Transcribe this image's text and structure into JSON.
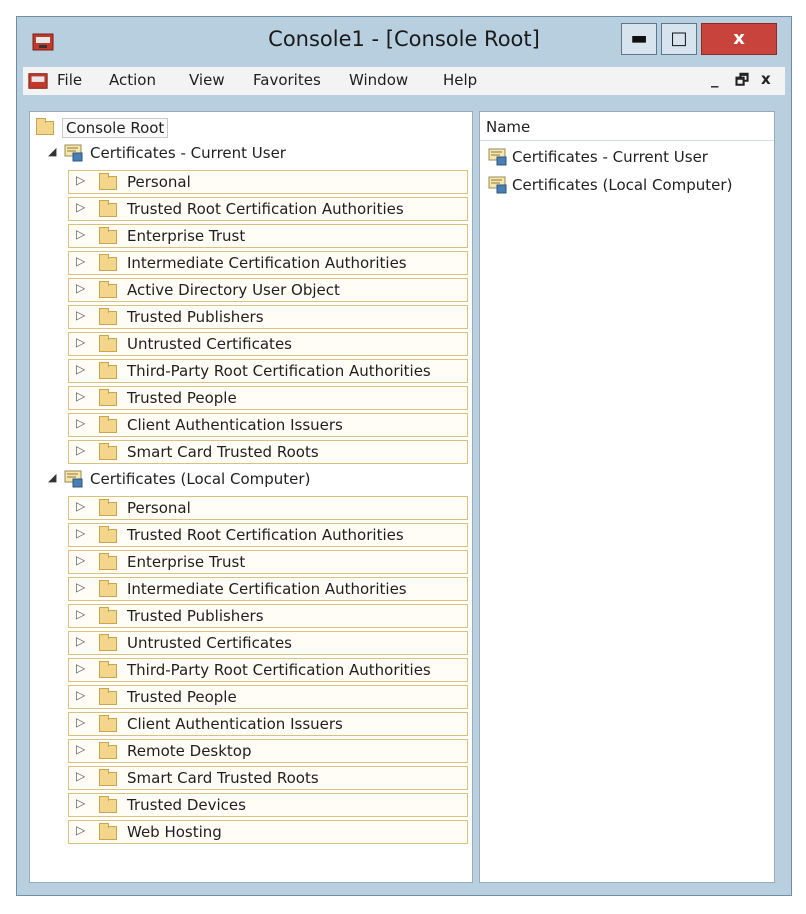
{
  "window": {
    "title": "Console1 - [Console Root]",
    "controls": {
      "minimize": "▬",
      "maximize": "□",
      "close": "x"
    }
  },
  "menu": {
    "items": [
      "File",
      "Action",
      "View",
      "Favorites",
      "Window",
      "Help"
    ],
    "mdi_controls": {
      "minimize": "_",
      "restore": "🗗",
      "close": "x"
    }
  },
  "tree": {
    "root_label": "Console Root",
    "groups": [
      {
        "label": "Certificates - Current User",
        "items": [
          "Personal",
          "Trusted Root Certification Authorities",
          "Enterprise Trust",
          "Intermediate Certification Authorities",
          "Active Directory User Object",
          "Trusted Publishers",
          "Untrusted Certificates",
          "Third-Party Root Certification Authorities",
          "Trusted People",
          "Client Authentication Issuers",
          "Smart Card Trusted Roots"
        ]
      },
      {
        "label": "Certificates (Local Computer)",
        "items": [
          "Personal",
          "Trusted Root Certification Authorities",
          "Enterprise Trust",
          "Intermediate Certification Authorities",
          "Trusted Publishers",
          "Untrusted Certificates",
          "Third-Party Root Certification Authorities",
          "Trusted People",
          "Client Authentication Issuers",
          "Remote Desktop",
          "Smart Card Trusted Roots",
          "Trusted Devices",
          "Web Hosting"
        ]
      }
    ]
  },
  "list": {
    "column_header": "Name",
    "items": [
      "Certificates - Current User",
      "Certificates (Local Computer)"
    ]
  }
}
